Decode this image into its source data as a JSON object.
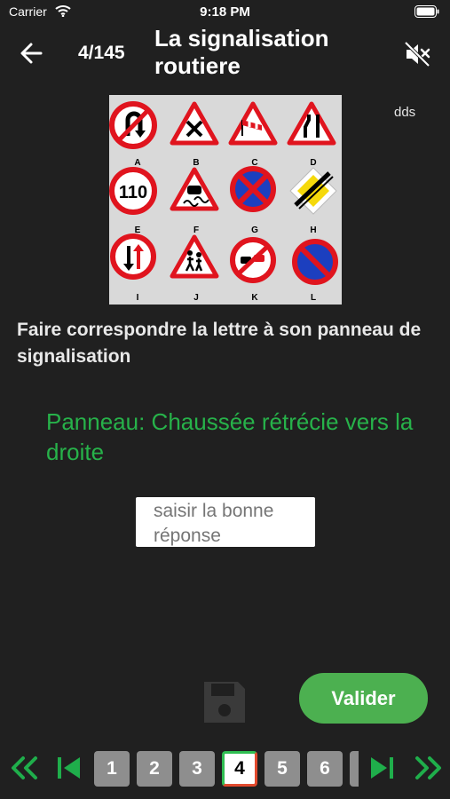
{
  "status": {
    "carrier": "Carrier",
    "time": "9:18 PM"
  },
  "header": {
    "counter": "4/145",
    "title": "La signalisation routiere"
  },
  "signs": {
    "letters": [
      "A",
      "B",
      "C",
      "D",
      "E",
      "F",
      "G",
      "H",
      "I",
      "J",
      "K",
      "L"
    ],
    "speed_limit": "110"
  },
  "side_label": "dds",
  "question": "Faire correspondre la lettre à son panneau de signalisation",
  "answer_hint": "Panneau: Chaussée rétrécie vers la droite",
  "input": {
    "placeholder": "saisir la bonne réponse"
  },
  "validate_label": "Valider",
  "pager": {
    "pages": [
      "1",
      "2",
      "3",
      "4",
      "5",
      "6"
    ],
    "current": "4"
  },
  "colors": {
    "background": "#202020",
    "accent_green": "#27b24a",
    "button_green": "#4cb050",
    "page_grey": "#8e8e8e"
  }
}
